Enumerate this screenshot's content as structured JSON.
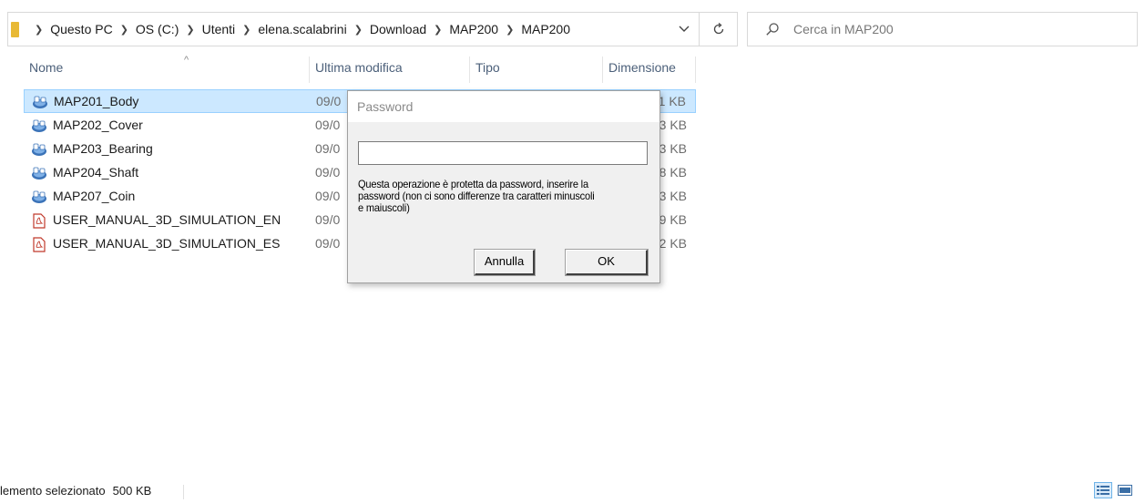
{
  "breadcrumb": [
    "Questo PC",
    "OS (C:)",
    "Utenti",
    "elena.scalabrini",
    "Download",
    "MAP200",
    "MAP200"
  ],
  "search": {
    "placeholder": "Cerca in MAP200"
  },
  "columns": {
    "name": "Nome",
    "date": "Ultima modifica",
    "type": "Tipo",
    "size": "Dimensione"
  },
  "files": [
    {
      "name": "MAP201_Body",
      "date": "09/0",
      "size": "1 KB",
      "icon": "app-icon"
    },
    {
      "name": "MAP202_Cover",
      "date": "09/0",
      "size": "3 KB",
      "icon": "app-icon"
    },
    {
      "name": "MAP203_Bearing",
      "date": "09/0",
      "size": "3 KB",
      "icon": "app-icon"
    },
    {
      "name": "MAP204_Shaft",
      "date": "09/0",
      "size": "8 KB",
      "icon": "app-icon"
    },
    {
      "name": "MAP207_Coin",
      "date": "09/0",
      "size": "3 KB",
      "icon": "app-icon"
    },
    {
      "name": "USER_MANUAL_3D_SIMULATION_EN",
      "date": "09/0",
      "size": "9 KB",
      "icon": "pdf-icon"
    },
    {
      "name": "USER_MANUAL_3D_SIMULATION_ES",
      "date": "09/0",
      "size": "2 KB",
      "icon": "pdf-icon"
    }
  ],
  "dialog": {
    "title": "Password",
    "input_value": "",
    "message_lines": [
      "Questa operazione è protetta da password, inserire la",
      "password (non ci sono differenze tra caratteri minuscoli",
      "e maiuscoli)"
    ],
    "cancel_label": "Annulla",
    "ok_label": "OK"
  },
  "status": {
    "selection": "lemento selezionato",
    "size": "500 KB"
  },
  "colors": {
    "selection_bg": "#cce8ff",
    "selection_border": "#99d1ff",
    "header_text": "#4c607a",
    "folder": "#e8b935"
  }
}
